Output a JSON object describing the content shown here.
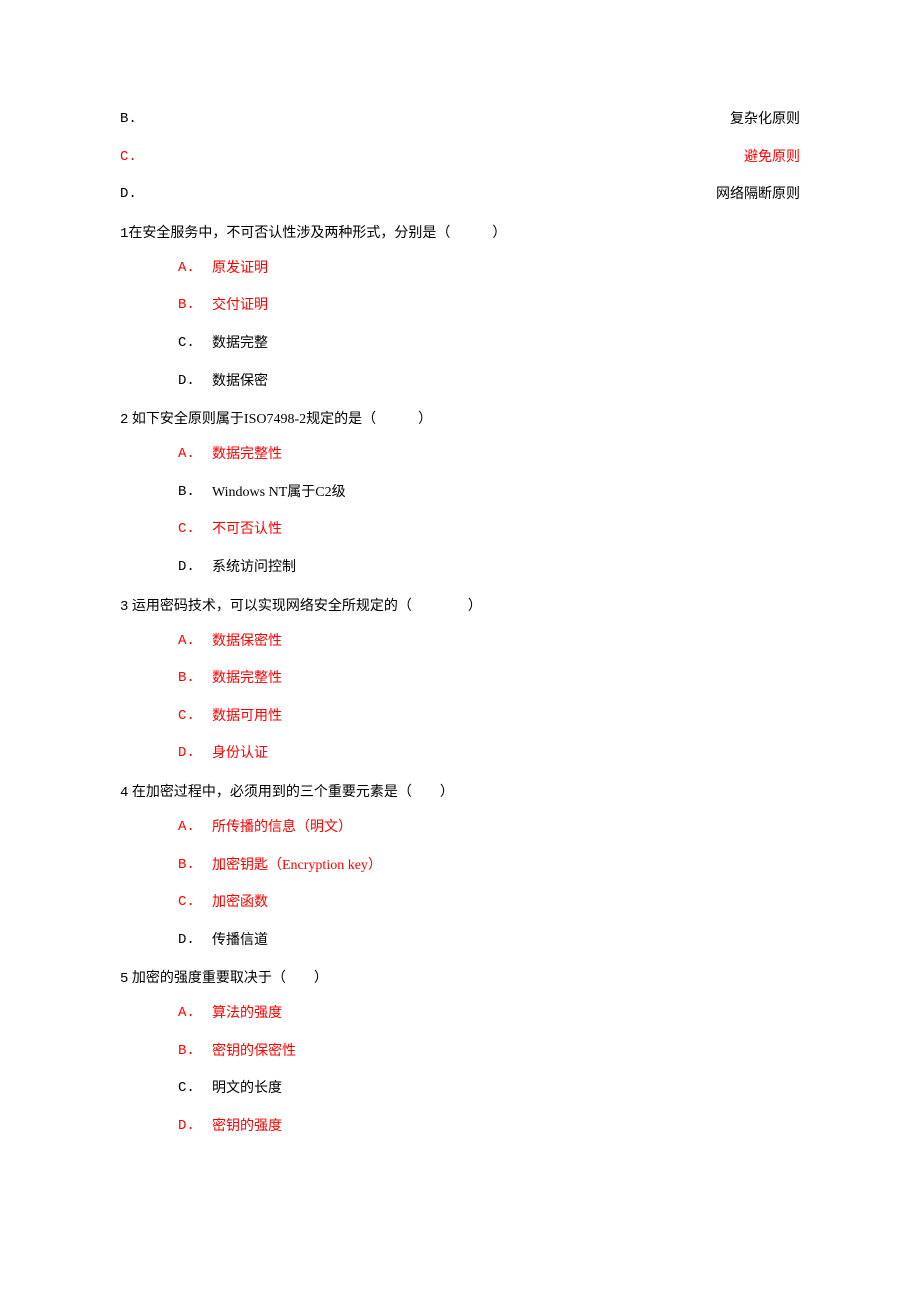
{
  "top_options": [
    {
      "letter": "B.",
      "text": "复杂化原则",
      "highlight": false
    },
    {
      "letter": "C.",
      "text": "避免原则",
      "highlight": true
    },
    {
      "letter": "D.",
      "text": "网络隔断原则",
      "highlight": false
    }
  ],
  "questions": [
    {
      "num": "1",
      "text": "在安全服务中，不可否认性涉及两种形式，分别是（　　　）",
      "options": [
        {
          "letter": "A.",
          "text": "原发证明",
          "highlight": true
        },
        {
          "letter": "B.",
          "text": "交付证明",
          "highlight": true
        },
        {
          "letter": "C.",
          "text": "数据完整",
          "highlight": false
        },
        {
          "letter": "D.",
          "text": "数据保密",
          "highlight": false
        }
      ]
    },
    {
      "num": "2",
      "text": " 如下安全原则属于ISO7498-2规定的是（　　　）",
      "options": [
        {
          "letter": "A.",
          "text": "数据完整性",
          "highlight": true
        },
        {
          "letter": "B.",
          "text": "Windows NT属于C2级",
          "highlight": false
        },
        {
          "letter": "C.",
          "text": "不可否认性",
          "highlight": true
        },
        {
          "letter": "D.",
          "text": "系统访问控制",
          "highlight": false
        }
      ]
    },
    {
      "num": "3",
      "text": " 运用密码技术，可以实现网络安全所规定的（　　　　）",
      "options": [
        {
          "letter": "A.",
          "text": "数据保密性",
          "highlight": true
        },
        {
          "letter": "B.",
          "text": "数据完整性",
          "highlight": true
        },
        {
          "letter": "C.",
          "text": "数据可用性",
          "highlight": true
        },
        {
          "letter": "D.",
          "text": "身份认证",
          "highlight": true
        }
      ]
    },
    {
      "num": "4",
      "text": " 在加密过程中，必须用到的三个重要元素是（　　）",
      "options": [
        {
          "letter": "A.",
          "text": "所传播的信息（明文）",
          "highlight": true
        },
        {
          "letter": "B.",
          "text": "加密钥匙（Encryption key）",
          "highlight": true
        },
        {
          "letter": "C.",
          "text": "加密函数",
          "highlight": true
        },
        {
          "letter": "D.",
          "text": "传播信道",
          "highlight": false
        }
      ]
    },
    {
      "num": "5",
      "text": " 加密的强度重要取决于（　　）",
      "options": [
        {
          "letter": "A.",
          "text": "算法的强度",
          "highlight": true
        },
        {
          "letter": "B.",
          "text": "密钥的保密性",
          "highlight": true
        },
        {
          "letter": "C.",
          "text": "明文的长度",
          "highlight": false
        },
        {
          "letter": "D.",
          "text": "密钥的强度",
          "highlight": true
        }
      ]
    }
  ]
}
